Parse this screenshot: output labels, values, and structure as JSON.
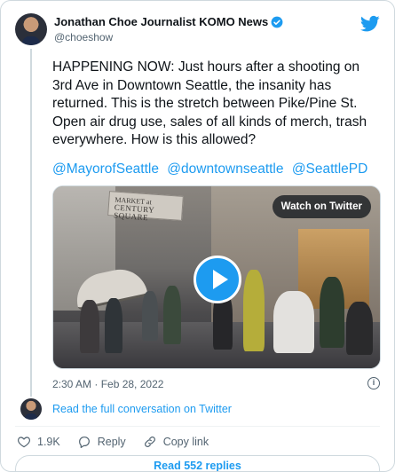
{
  "author": {
    "name": "Jonathan Choe Journalist KOMO News",
    "handle": "@choeshow",
    "verified": true
  },
  "tweet": {
    "text": "HAPPENING NOW: Just hours after a shooting on 3rd Ave in Downtown Seattle, the insanity has returned. This is the stretch between Pike/Pine St. Open air drug use, sales of all kinds of merch, trash everywhere. How is this allowed?",
    "mentions": [
      "@MayorofSeattle",
      "@downtownseattle",
      "@SeattlePD"
    ],
    "timestamp": "2:30 AM · Feb 28, 2022"
  },
  "media": {
    "watch_label": "Watch on Twitter",
    "sign_line1": "MARKET at",
    "sign_line2": "CENTURY SQUARE"
  },
  "conversation": {
    "link_label": "Read the full conversation on Twitter"
  },
  "actions": {
    "like_count": "1.9K",
    "reply_label": "Reply",
    "copy_link_label": "Copy link"
  },
  "replies": {
    "button_label": "Read 552 replies"
  },
  "colors": {
    "accent": "#1d9bf0",
    "text": "#0f1419",
    "muted": "#536471",
    "border": "#cfd9de"
  },
  "icons": {
    "brand": "twitter-bird-icon",
    "verified": "verified-badge-icon",
    "info": "info-icon",
    "like": "heart-icon",
    "reply": "reply-bubble-icon",
    "copy": "link-icon",
    "play": "play-icon"
  }
}
